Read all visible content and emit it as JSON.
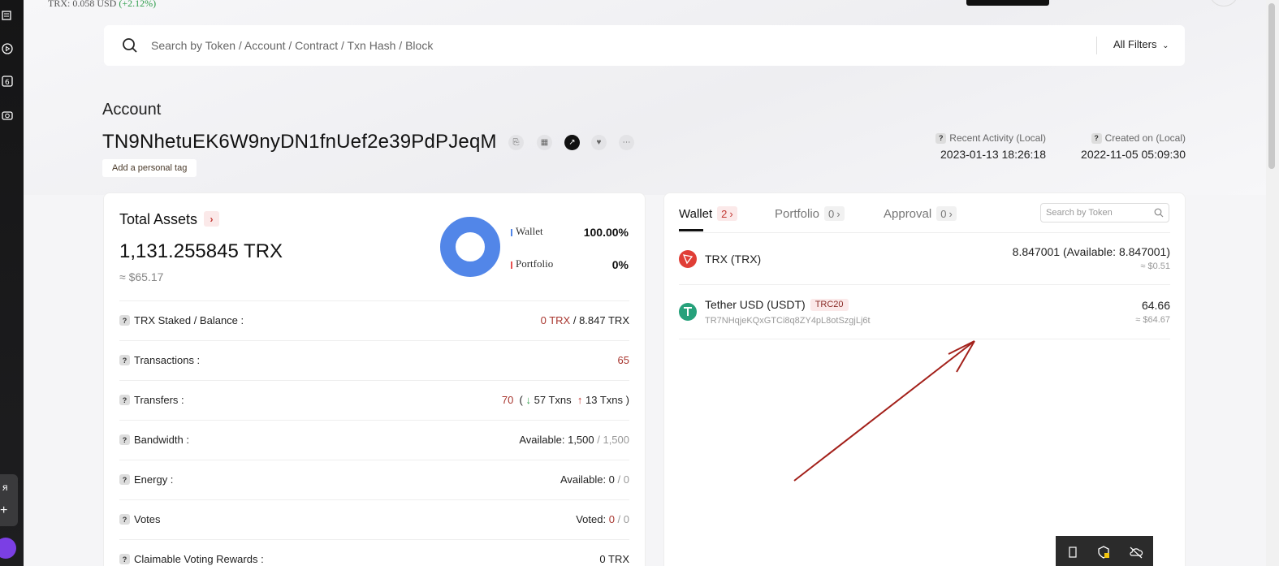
{
  "top_price": {
    "label": "TRX: 0.058 USD",
    "change": "(+2.12%)"
  },
  "search": {
    "placeholder": "Search by Token / Account / Contract / Txn Hash / Block",
    "filters_label": "All Filters"
  },
  "account": {
    "title": "Account",
    "address": "TN9NhetuEK6W9nyDN1fnUef2e39PdPJeqM",
    "tag_button": "Add a personal tag",
    "recent_activity_label": "Recent Activity (Local)",
    "recent_activity_value": "2023-01-13 18:26:18",
    "created_label": "Created on (Local)",
    "created_value": "2022-11-05 05:09:30"
  },
  "total_assets": {
    "title": "Total Assets",
    "amount": "1,131.255845 TRX",
    "usd": "≈ $65.17",
    "legend": [
      {
        "name": "Wallet",
        "value": "100.00%",
        "color": "#5286e8"
      },
      {
        "name": "Portfolio",
        "value": "0%",
        "color": "#e85252"
      }
    ]
  },
  "stats": {
    "staked": {
      "label": "TRX Staked / Balance :",
      "staked": "0 TRX",
      "sep": " / ",
      "balance": "8.847 TRX"
    },
    "transactions": {
      "label": "Transactions :",
      "value": "65"
    },
    "transfers": {
      "label": "Transfers :",
      "total": "70",
      "open": "(",
      "in": "57 Txns",
      "out": "13 Txns",
      "close": ")"
    },
    "bandwidth": {
      "label": "Bandwidth :",
      "available": "Available: 1,500",
      "total": " / 1,500"
    },
    "energy": {
      "label": "Energy :",
      "available": "Available: 0",
      "total": " / 0"
    },
    "votes": {
      "label": "Votes",
      "prefix": "Voted: ",
      "voted": "0",
      "total": " / 0"
    },
    "rewards": {
      "label": "Claimable Voting Rewards :",
      "value": "0 TRX"
    }
  },
  "wallet_panel": {
    "tabs": [
      {
        "label": "Wallet",
        "count": "2"
      },
      {
        "label": "Portfolio",
        "count": "0"
      },
      {
        "label": "Approval",
        "count": "0"
      }
    ],
    "search_placeholder": "Search by Token",
    "tokens": [
      {
        "name": "TRX (TRX)",
        "amount": "8.847001 (Available: 8.847001)",
        "usd": "≈ $0.51",
        "color": "#e03e36"
      },
      {
        "name": "Tether USD (USDT)",
        "badge": "TRC20",
        "address": "TR7NHqjeKQxGTCi8q8ZY4pL8otSzgjLj6t",
        "amount": "64.66",
        "usd": "≈ $64.67",
        "color": "#26a17b"
      }
    ]
  },
  "rail": {
    "side_char": "я"
  }
}
